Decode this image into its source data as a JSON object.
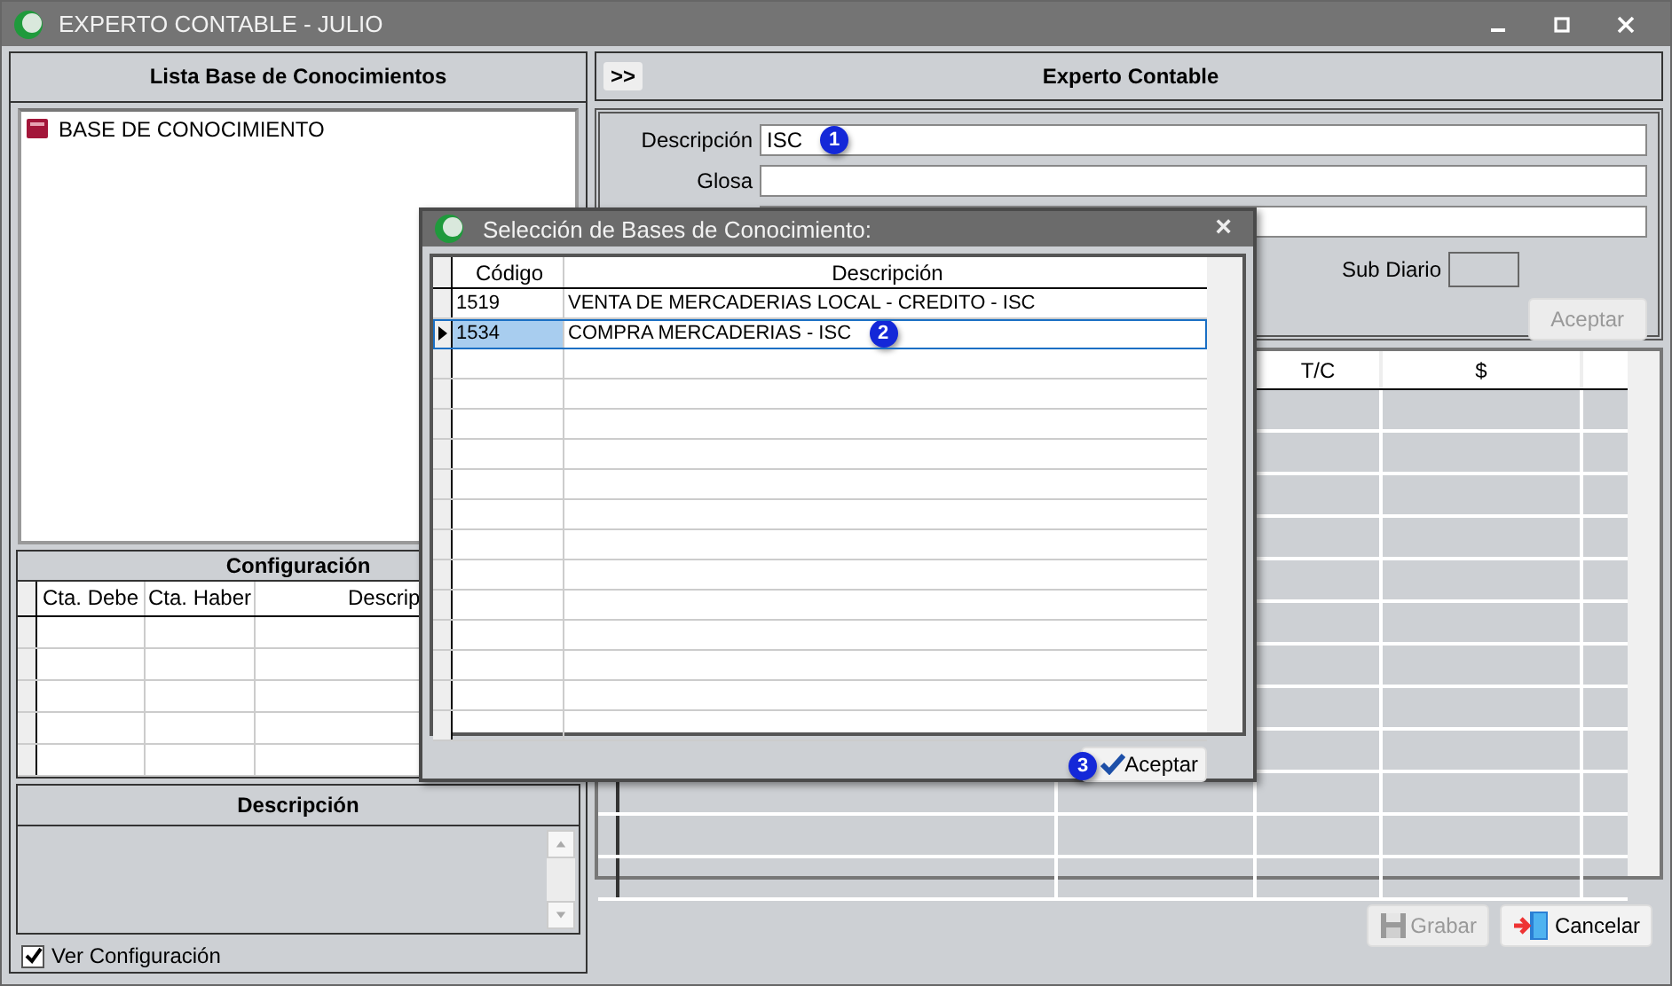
{
  "window": {
    "title": "EXPERTO CONTABLE - JULIO"
  },
  "left_panel": {
    "title": "Lista Base de Conocimientos",
    "tree": [
      {
        "label": "BASE DE CONOCIMIENTO"
      }
    ],
    "configuracion": {
      "title": "Configuración",
      "columns": [
        "Cta. Debe",
        "Cta. Haber",
        "Descrip"
      ]
    },
    "descripcion": {
      "title": "Descripción"
    },
    "ver_configuracion": {
      "label": "Ver Configuración",
      "checked": true
    }
  },
  "right_panel": {
    "toggle": ">>",
    "title": "Experto Contable",
    "fields": [
      {
        "kind": "text",
        "label": "Descripción",
        "value": "ISC",
        "badge": "1"
      },
      {
        "kind": "text",
        "label": "Glosa"
      },
      {
        "kind": "text"
      }
    ],
    "sub_diario": {
      "label": "Sub Diario"
    },
    "accept_button": {
      "label": "Aceptar",
      "disabled": true
    },
    "grid": {
      "columns": [
        "T/C",
        "$"
      ]
    },
    "buttons": [
      {
        "kind": "save",
        "label": "Grabar",
        "disabled": true
      },
      {
        "kind": "exit",
        "label": "Cancelar",
        "disabled": false
      }
    ]
  },
  "dialog": {
    "title": "Selección de Bases de Conocimiento:",
    "close": "×",
    "columns": [
      "Código",
      "Descripción"
    ],
    "rows": [
      {
        "codigo": "1519",
        "descripcion": "VENTA DE MERCADERIAS LOCAL - CREDITO - ISC",
        "selected": false
      },
      {
        "codigo": "1534",
        "descripcion": "COMPRA MERCADERIAS - ISC",
        "selected": true,
        "badge": "2"
      }
    ],
    "accept_button": {
      "label": "Aceptar",
      "badge": "3"
    }
  }
}
